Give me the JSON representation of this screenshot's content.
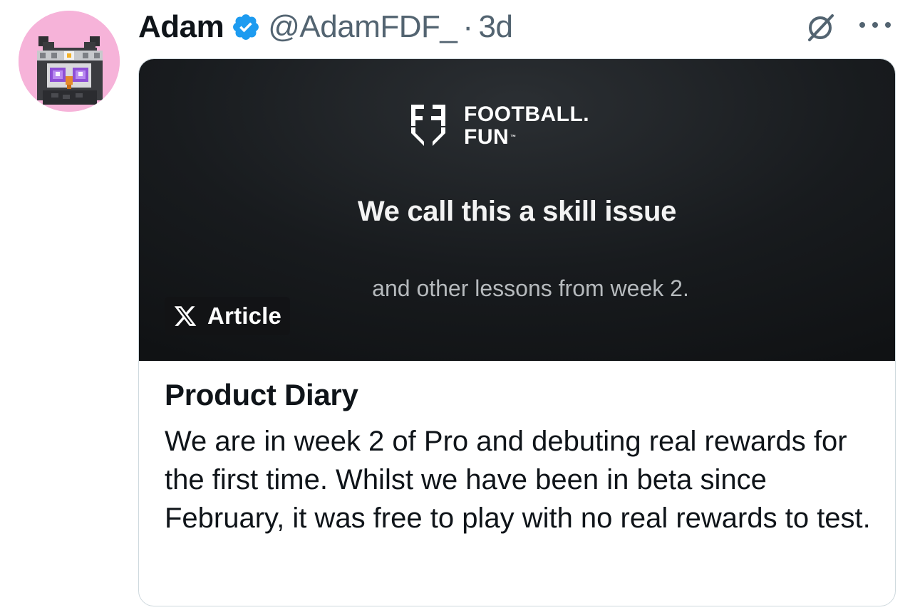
{
  "tweet": {
    "author": {
      "display_name": "Adam",
      "handle": "@AdamFDF_",
      "verified": true,
      "verified_icon": "verified-badge-icon",
      "avatar": "pixel-owl-avatar"
    },
    "separator": "·",
    "timestamp": "3d",
    "actions": {
      "grok_icon": "grok-icon",
      "more_icon": "more-dots-icon"
    }
  },
  "article_card": {
    "media": {
      "logo_line1": "FOOTBALL.",
      "logo_line2": "FUN",
      "logo_tm": "™",
      "headline": "We call this a skill issue",
      "subheadline": "and other lessons from week 2."
    },
    "badge": {
      "icon": "x-logo-icon",
      "label": "Article"
    },
    "title": "Product Diary",
    "excerpt": "We are in week 2 of Pro and debuting real rewards for the first time. Whilst we have been in beta since February, it was free to play with no real rewards to test."
  },
  "colors": {
    "verified_blue": "#1d9bf0",
    "text_primary": "#0f1419",
    "text_secondary": "#536471",
    "card_border": "#cfd9de",
    "avatar_bg": "#f6b3d9",
    "media_bg": "#1a1d20"
  }
}
